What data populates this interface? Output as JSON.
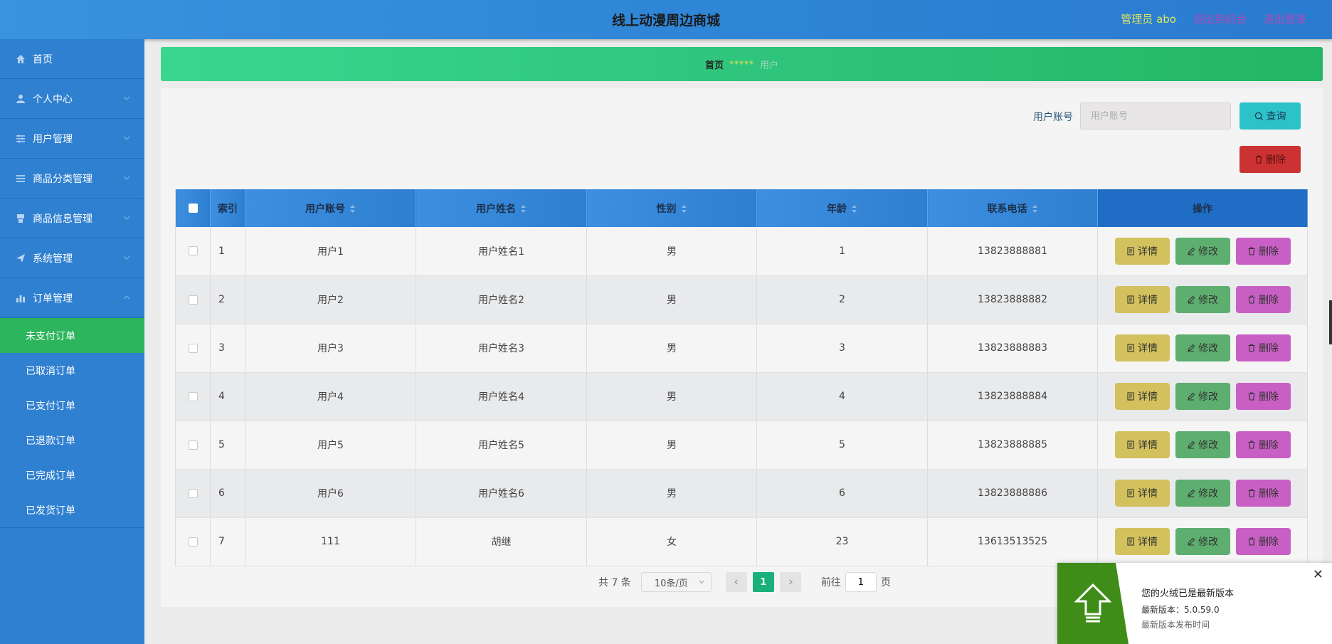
{
  "header": {
    "title": "线上动漫周边商城",
    "admin_label": "管理员 abo",
    "to_front": "退出到前台",
    "logout": "退出登录"
  },
  "sidebar": {
    "items": [
      {
        "label": "首页",
        "icon": "home-icon"
      },
      {
        "label": "个人中心",
        "icon": "user-icon"
      },
      {
        "label": "用户管理",
        "icon": "sliders-icon"
      },
      {
        "label": "商品分类管理",
        "icon": "list-icon"
      },
      {
        "label": "商品信息管理",
        "icon": "info-icon"
      },
      {
        "label": "系统管理",
        "icon": "send-icon"
      },
      {
        "label": "订单管理",
        "icon": "bar-chart-icon"
      }
    ],
    "sub_items": [
      "未支付订单",
      "已取消订单",
      "已支付订单",
      "已退款订单",
      "已完成订单",
      "已发货订单"
    ]
  },
  "breadcrumb": {
    "home": "首页",
    "separator": "*****",
    "current": "用户"
  },
  "search": {
    "label": "用户账号",
    "placeholder": "用户账号",
    "query_button": "查询",
    "delete_button": "删除"
  },
  "table": {
    "headers": [
      "索引",
      "用户账号",
      "用户姓名",
      "性别",
      "年龄",
      "联系电话",
      "操作"
    ],
    "rows": [
      {
        "index": "1",
        "account": "用户1",
        "name": "用户姓名1",
        "gender": "男",
        "age": "1",
        "phone": "13823888881"
      },
      {
        "index": "2",
        "account": "用户2",
        "name": "用户姓名2",
        "gender": "男",
        "age": "2",
        "phone": "13823888882"
      },
      {
        "index": "3",
        "account": "用户3",
        "name": "用户姓名3",
        "gender": "男",
        "age": "3",
        "phone": "13823888883"
      },
      {
        "index": "4",
        "account": "用户4",
        "name": "用户姓名4",
        "gender": "男",
        "age": "4",
        "phone": "13823888884"
      },
      {
        "index": "5",
        "account": "用户5",
        "name": "用户姓名5",
        "gender": "男",
        "age": "5",
        "phone": "13823888885"
      },
      {
        "index": "6",
        "account": "用户6",
        "name": "用户姓名6",
        "gender": "男",
        "age": "6",
        "phone": "13823888886"
      },
      {
        "index": "7",
        "account": "111",
        "name": "胡继",
        "gender": "女",
        "age": "23",
        "phone": "13613513525"
      }
    ],
    "actions": {
      "detail": "详情",
      "edit": "修改",
      "delete": "删除"
    }
  },
  "pagination": {
    "total": "共 7 条",
    "page_size": "10条/页",
    "current_page": "1",
    "goto_prefix": "前往",
    "goto_value": "1",
    "goto_suffix": "页"
  },
  "toast": {
    "title": "您的火绒已是最新版本",
    "version": "最新版本：5.0.59.0",
    "date_label": "最新版本发布时间"
  },
  "colors": {
    "header": "#2f86d6",
    "sidebar": "#2f80d1",
    "active_menu": "#2db55d",
    "detail_btn": "#d2c15c",
    "edit_btn": "#5dae6f",
    "delete_btn": "#c85fc4"
  }
}
